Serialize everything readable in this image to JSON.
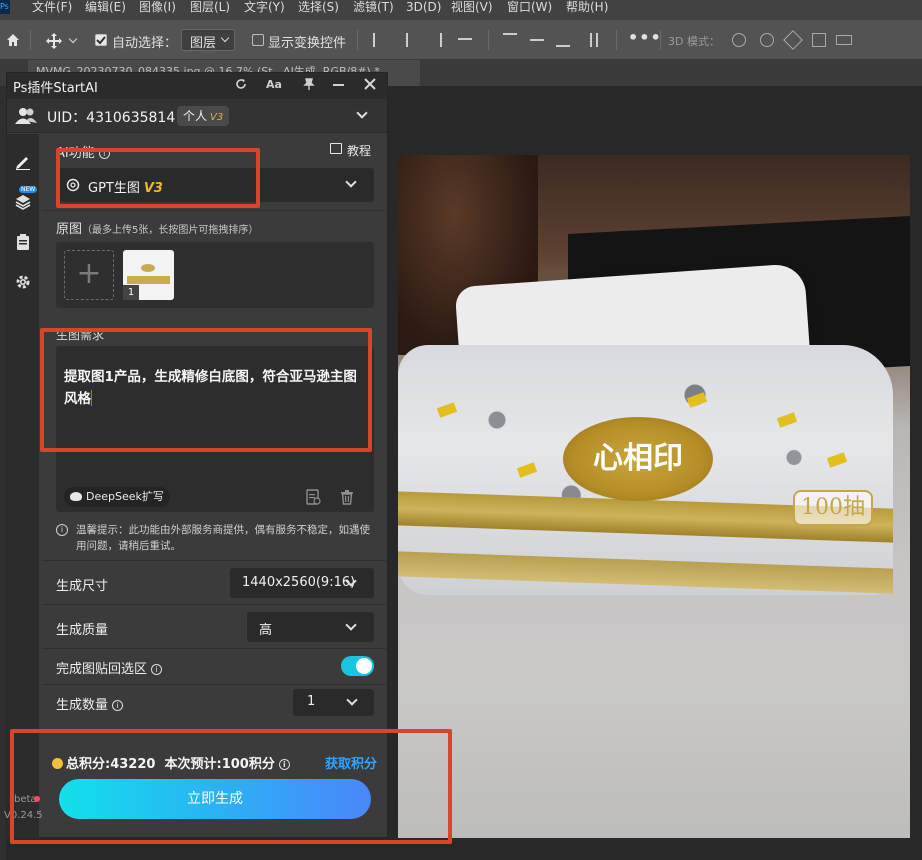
{
  "menubar": {
    "app_icon": "Ps",
    "items": [
      "文件(F)",
      "编辑(E)",
      "图像(I)",
      "图层(L)",
      "文字(Y)",
      "选择(S)",
      "滤镜(T)",
      "3D(D)",
      "视图(V)",
      "窗口(W)",
      "帮助(H)"
    ]
  },
  "options": {
    "auto_select_label": "自动选择：",
    "auto_select_value": "图层",
    "show_transform_label": "显示变换控件",
    "mode_3d_label": "3D 模式："
  },
  "doc_tab": {
    "title": "MVMG_20230730_084335.jpg @ 16.7% (St...AI生成, RGB/8#) *"
  },
  "panel": {
    "title": "Ps插件StartAI",
    "uid": "UID：4310635814",
    "user_tier": "个人",
    "user_version": "V3",
    "new_badge": "NEW",
    "ai_function_label": "AI功能",
    "tutorial_label": "教程",
    "model_name": "GPT生图",
    "model_version": "V3",
    "source_label": "原图",
    "source_hint": "（最多上传5张，长按图片可拖拽排序）",
    "thumb_index": "1",
    "prompt_label": "生图需求",
    "prompt_text": "提取图1产品，生成精修白底图，符合亚马逊主图风格",
    "deepseek_label": "DeepSeek扩写",
    "tip_text": "温馨提示：此功能由外部服务商提供，偶有服务不稳定，如遇使用问题，请稍后重试。",
    "size_label": "生成尺寸",
    "size_value": "1440x2560(9:16)",
    "quality_label": "生成质量",
    "quality_value": "高",
    "paste_back_label": "完成图贴回选区",
    "paste_back_on": true,
    "count_label": "生成数量",
    "count_value": "1",
    "points_text": "总积分:43220",
    "estimate_text": "本次预计:100积分",
    "get_points_label": "获取积分",
    "generate_label": "立即生成",
    "beta_label": "beta",
    "version_label": "V0.24.5"
  },
  "photo": {
    "brand_text": "心相印",
    "badge_text": "100抽"
  },
  "colors": {
    "accent_cyan": "#16c5e0",
    "accent_blue": "#2fa3ff",
    "annotation_red": "#d9452b",
    "version_gold": "#f1b630"
  }
}
